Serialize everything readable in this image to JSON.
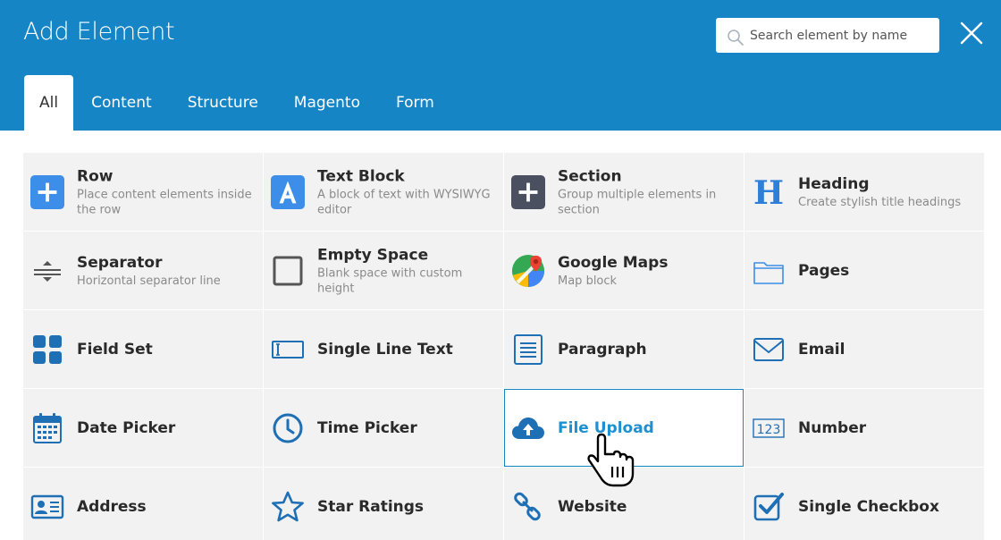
{
  "dialog": {
    "title": "Add Element"
  },
  "search": {
    "placeholder": "Search element by name"
  },
  "tabs": [
    {
      "label": "All"
    },
    {
      "label": "Content"
    },
    {
      "label": "Structure"
    },
    {
      "label": "Magento"
    },
    {
      "label": "Form"
    }
  ],
  "active_tab": "All",
  "elements": [
    {
      "name": "Row",
      "desc": "Place content elements inside the row",
      "icon": "plus-square-icon",
      "color": "#3d8ee8"
    },
    {
      "name": "Text Block",
      "desc": "A block of text with WYSIWYG editor",
      "icon": "letter-a-icon",
      "color": "#3d8ee8"
    },
    {
      "name": "Section",
      "desc": "Group multiple elements in section",
      "icon": "plus-square-dark-icon",
      "color": "#4a5060"
    },
    {
      "name": "Heading",
      "desc": "Create stylish title headings",
      "icon": "letter-h-icon",
      "color": "#2e7fd8"
    },
    {
      "name": "Separator",
      "desc": "Horizontal separator line",
      "icon": "separator-icon",
      "color": "#555555"
    },
    {
      "name": "Empty Space",
      "desc": "Blank space with custom height",
      "icon": "empty-square-icon",
      "color": "#555555"
    },
    {
      "name": "Google Maps",
      "desc": "Map block",
      "icon": "google-maps-icon",
      "color": "#34a853"
    },
    {
      "name": "Pages",
      "desc": "",
      "icon": "folder-icon",
      "color": "#3d8ee8"
    },
    {
      "name": "Field Set",
      "desc": "",
      "icon": "grid-four-icon",
      "color": "#1f6fb5"
    },
    {
      "name": "Single Line Text",
      "desc": "",
      "icon": "text-field-icon",
      "color": "#1f6fb5"
    },
    {
      "name": "Paragraph",
      "desc": "",
      "icon": "paragraph-icon",
      "color": "#1f6fb5"
    },
    {
      "name": "Email",
      "desc": "",
      "icon": "envelope-icon",
      "color": "#1f6fb5"
    },
    {
      "name": "Date Picker",
      "desc": "",
      "icon": "calendar-icon",
      "color": "#1f6fb5"
    },
    {
      "name": "Time Picker",
      "desc": "",
      "icon": "clock-icon",
      "color": "#1f6fb5"
    },
    {
      "name": "File Upload",
      "desc": "",
      "icon": "cloud-upload-icon",
      "color": "#1f6fb5"
    },
    {
      "name": "Number",
      "desc": "",
      "icon": "number-icon",
      "color": "#1f6fb5",
      "icon_text": "123"
    },
    {
      "name": "Address",
      "desc": "",
      "icon": "address-card-icon",
      "color": "#1f6fb5"
    },
    {
      "name": "Star Ratings",
      "desc": "",
      "icon": "star-icon",
      "color": "#1f6fb5"
    },
    {
      "name": "Website",
      "desc": "",
      "icon": "link-icon",
      "color": "#1f6fb5"
    },
    {
      "name": "Single Checkbox",
      "desc": "",
      "icon": "checkbox-icon",
      "color": "#1f6fb5"
    }
  ],
  "hovered_element": "File Upload",
  "colors": {
    "header": "#1585c6",
    "cell": "#f2f2f2",
    "accent": "#1e8fcf"
  }
}
